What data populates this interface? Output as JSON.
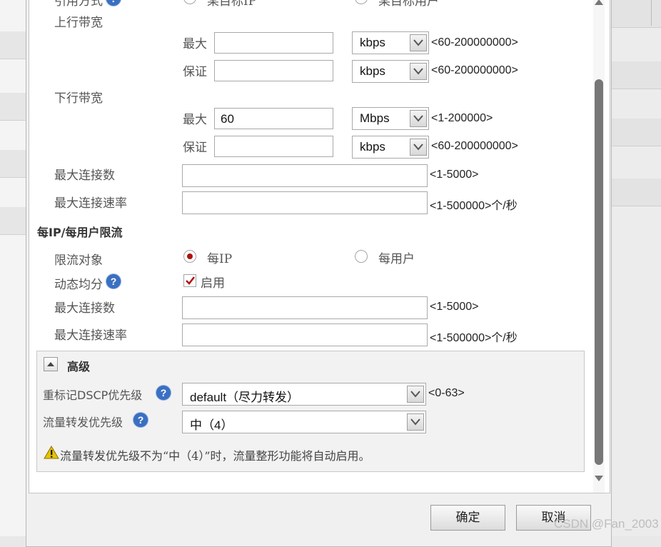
{
  "top_partial": {
    "label": "引用方式",
    "option_left": "某目标IP",
    "option_right": "某目标用户"
  },
  "upload_bandwidth": {
    "title": "上行带宽",
    "max": {
      "label": "最大",
      "value": "",
      "unit": "kbps",
      "range": "<60-200000000>"
    },
    "guarantee": {
      "label": "保证",
      "value": "",
      "unit": "kbps",
      "range": "<60-200000000>"
    }
  },
  "download_bandwidth": {
    "title": "下行带宽",
    "max": {
      "label": "最大",
      "value": "60",
      "unit": "Mbps",
      "range": "<1-200000>"
    },
    "guarantee": {
      "label": "保证",
      "value": "",
      "unit": "kbps",
      "range": "<60-200000000>"
    }
  },
  "max_connections": {
    "label": "最大连接数",
    "value": "",
    "range": "<1-5000>"
  },
  "max_connection_rate": {
    "label": "最大连接速率",
    "value": "",
    "range": "<1-500000>个/秒"
  },
  "per_ip_section": {
    "title": "每IP/每用户限流",
    "target": {
      "label": "限流对象",
      "option_ip": "每IP",
      "option_user": "每用户",
      "selected": "每IP"
    },
    "dynamic_share": {
      "label": "动态均分",
      "checkbox_label": "启用",
      "checked": true
    },
    "max_connections": {
      "label": "最大连接数",
      "value": "",
      "range": "<1-5000>"
    },
    "max_connection_rate": {
      "label": "最大连接速率",
      "value": "",
      "range": "<1-500000>个/秒"
    }
  },
  "advanced": {
    "title": "高级",
    "dscp": {
      "label": "重标记DSCP优先级",
      "value": "default（尽力转发）",
      "range": "<0-63>"
    },
    "forward_priority": {
      "label": "流量转发优先级",
      "value": "中（4）"
    },
    "warning": "流量转发优先级不为“中（4）”时，流量整形功能将自动启用。"
  },
  "buttons": {
    "ok": "确定",
    "cancel": "取消"
  },
  "help_glyph": "?",
  "watermark": "CSDN @Fan_2003",
  "colors": {
    "help_icon": "#3a6fc2",
    "radio_selected": "#b01010",
    "check_mark": "#b01010",
    "warning_icon": "#e8c300"
  }
}
